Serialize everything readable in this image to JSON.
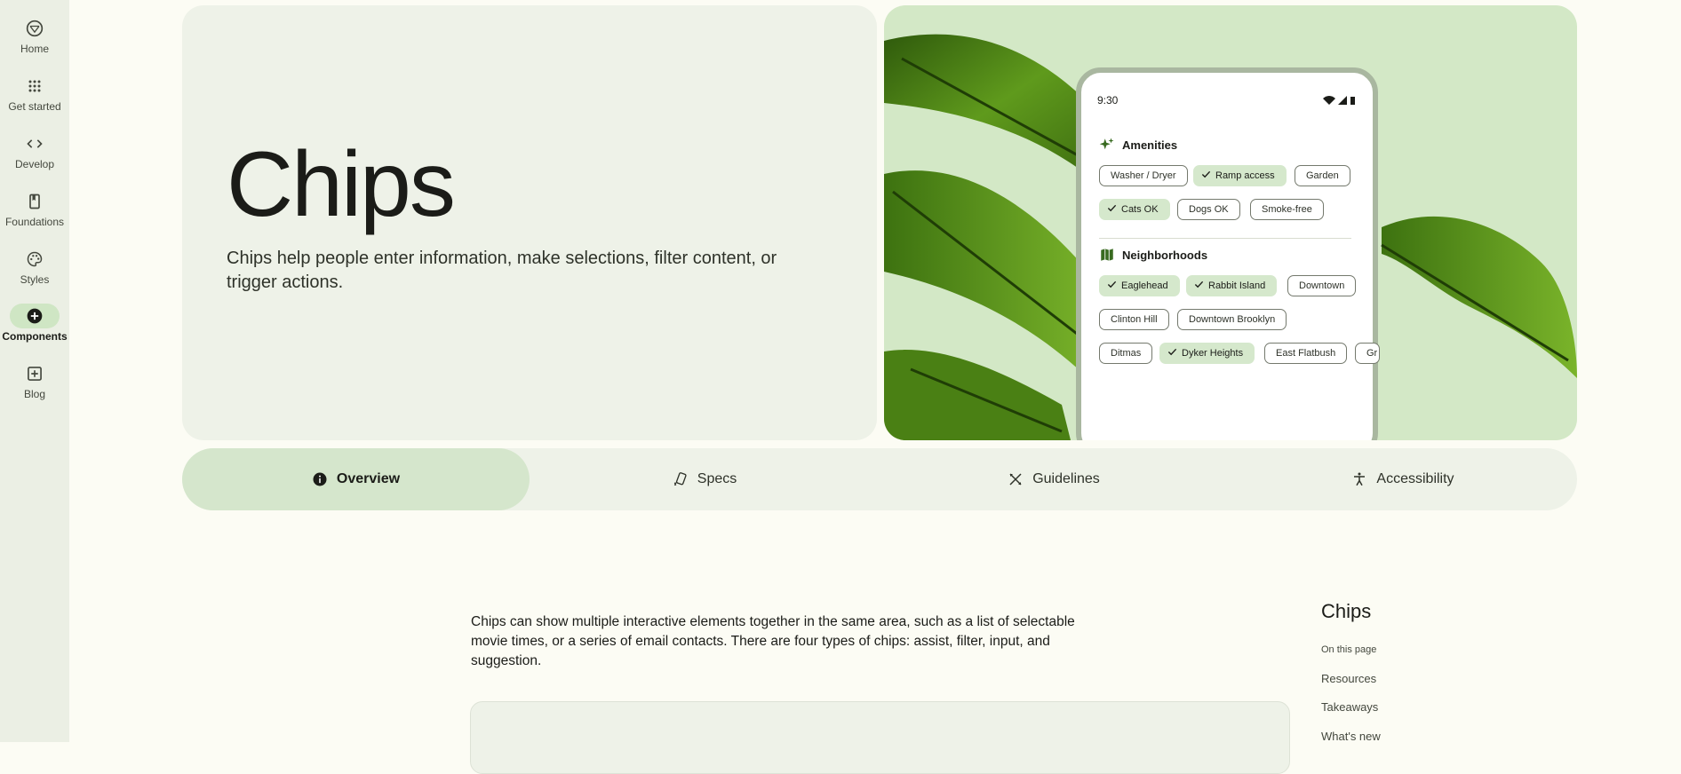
{
  "nav": {
    "items": [
      {
        "label": "Home",
        "icon": "material-logo-icon"
      },
      {
        "label": "Get started",
        "icon": "apps-grid-icon"
      },
      {
        "label": "Develop",
        "icon": "code-icon"
      },
      {
        "label": "Foundations",
        "icon": "book-icon"
      },
      {
        "label": "Styles",
        "icon": "palette-icon"
      },
      {
        "label": "Components",
        "icon": "add-circle-icon",
        "active": true
      },
      {
        "label": "Blog",
        "icon": "add-box-icon"
      }
    ]
  },
  "hero": {
    "title": "Chips",
    "description": "Chips help people enter information, make selections, filter content, or trigger actions."
  },
  "phone": {
    "time": "9:30",
    "amenities": {
      "title": "Amenities",
      "chips": [
        {
          "label": "Washer / Dryer",
          "selected": false
        },
        {
          "label": "Ramp access",
          "selected": true
        },
        {
          "label": "Garden",
          "selected": false
        },
        {
          "label": "Cats OK",
          "selected": true
        },
        {
          "label": "Dogs OK",
          "selected": false
        },
        {
          "label": "Smoke-free",
          "selected": false
        }
      ]
    },
    "neighborhoods": {
      "title": "Neighborhoods",
      "chips": [
        {
          "label": "Eaglehead",
          "selected": true
        },
        {
          "label": "Rabbit Island",
          "selected": true
        },
        {
          "label": "Downtown",
          "selected": false
        },
        {
          "label": "Clinton Hill",
          "selected": false
        },
        {
          "label": "Downtown Brooklyn",
          "selected": false
        },
        {
          "label": "Ditmas",
          "selected": false
        },
        {
          "label": "Dyker Heights",
          "selected": true
        },
        {
          "label": "East Flatbush",
          "selected": false
        },
        {
          "label": "Gr",
          "selected": false
        }
      ]
    }
  },
  "tabs": [
    {
      "label": "Overview",
      "icon": "info-icon",
      "active": true
    },
    {
      "label": "Specs",
      "icon": "specs-icon"
    },
    {
      "label": "Guidelines",
      "icon": "guidelines-icon"
    },
    {
      "label": "Accessibility",
      "icon": "accessibility-icon"
    }
  ],
  "content": {
    "intro": "Chips can show multiple interactive elements together in the same area, such as a list of selectable movie times, or a series of email contacts. There are four types of chips: assist, filter, input, and suggestion."
  },
  "toc": {
    "title": "Chips",
    "subtitle": "On this page",
    "links": [
      "Resources",
      "Takeaways",
      "What's new"
    ]
  },
  "colors": {
    "background": "#fcfcf4",
    "rail": "#ebefe4",
    "selected_chip": "#d5e8cc",
    "active_tab": "#d5e6cc",
    "hero_right": "#d3e8c6"
  }
}
